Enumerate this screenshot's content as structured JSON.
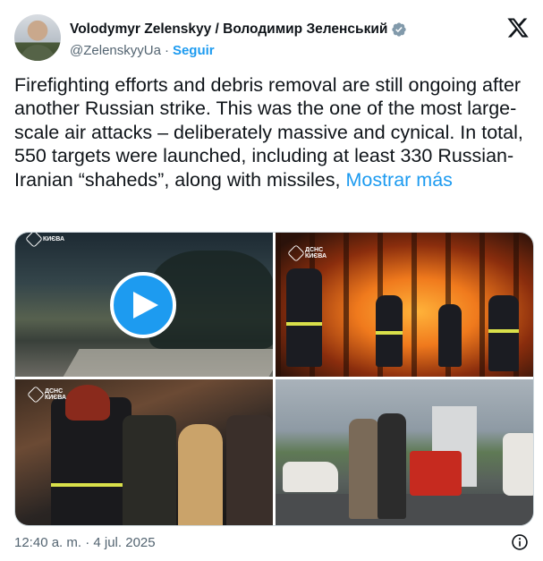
{
  "author": {
    "display_name": "Volodymyr Zelenskyy / Володимир Зеленський",
    "handle": "@ZelenskyyUa",
    "separator": "·",
    "follow_label": "Seguir",
    "verified_color": "#829aab"
  },
  "tweet": {
    "text": "Firefighting efforts and debris removal are still ongoing after another Russian strike. This was the one of the most large-scale air attacks – deliberately massive and cynical. In total, 550 targets were launched, including at least 330 Russian-Iranian “shaheds”, along with missiles, ",
    "show_more_label": "Mostrar más"
  },
  "media": {
    "tiles": [
      {
        "kind": "video",
        "badge_text": "КИЄВА"
      },
      {
        "kind": "photo",
        "badge_text": "ДСНС КИЄВА"
      },
      {
        "kind": "photo",
        "badge_text": "ДСНС КИЄВА"
      },
      {
        "kind": "photo",
        "badge_text": ""
      }
    ]
  },
  "footer": {
    "timestamp": "12:40 a. m. · 4 jul. 2025"
  },
  "colors": {
    "accent": "#1d9bf0",
    "text": "#0f1419",
    "secondary": "#536471",
    "border": "#cfd9de"
  },
  "icons": {
    "verified": "verified-badge-icon",
    "logo": "x-logo-icon",
    "play": "play-icon",
    "info": "info-icon"
  }
}
